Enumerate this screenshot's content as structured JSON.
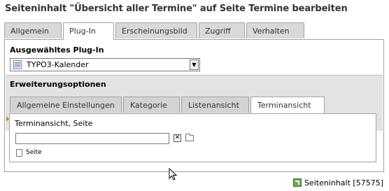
{
  "title": "Seiteninhalt \"Übersicht aller Termine\" auf Seite Termine bearbeiten",
  "tabs": [
    "Allgemein",
    "Plug-In",
    "Erscheinungsbild",
    "Zugriff",
    "Verhalten"
  ],
  "active_tab": "Plug-In",
  "plugin_section": {
    "heading": "Ausgewähltes Plug-In",
    "selected": "TYPO3-Kalender",
    "icon": "calendar-icon"
  },
  "options_section": {
    "heading": "Erweiterungsoptionen",
    "subtabs": [
      "Allgemeine Einstellungen",
      "Kategorie",
      "Listenansicht",
      "Terminansicht"
    ],
    "active_subtab": "Terminansicht",
    "field_label": "Terminansicht, Seite",
    "field_value": "",
    "page_label": "Seite"
  },
  "footer": {
    "text": "Seiteninhalt [57575]",
    "icon": "content-element-icon"
  },
  "colors": {
    "tab_bg": "#d9d9d9",
    "border": "#a2a2a2",
    "band_bg": "#e3e3e3",
    "marker": "#d28a2a",
    "footer_icon": "#6aa84f"
  }
}
